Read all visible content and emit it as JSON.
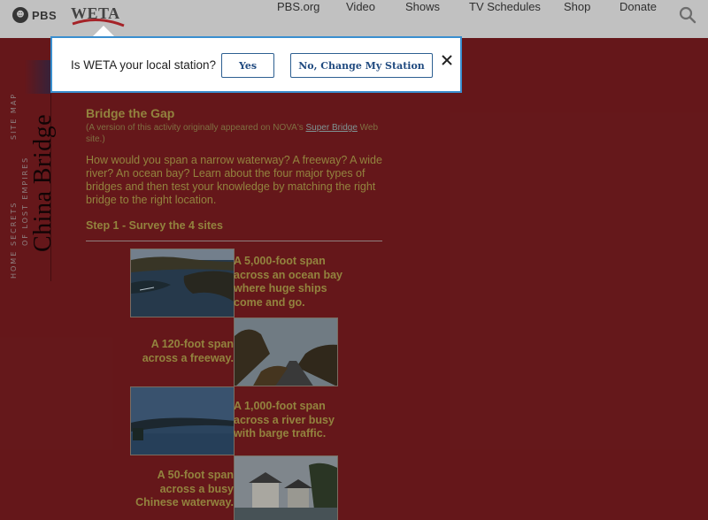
{
  "header": {
    "pbs_logo_text": "PBS",
    "station_logo_text": "WETA",
    "nav": [
      "PBS.org",
      "Video",
      "Shows",
      "TV Schedules",
      "Shop",
      "Donate"
    ]
  },
  "popup": {
    "question": "Is WETA your local station?",
    "yes_label": "Yes",
    "no_label": "No, Change My Station"
  },
  "leftnav": {
    "site_map": "SITE MAP",
    "secrets": "SECRETS",
    "lost_empires": "OF LOST EMPIRES",
    "home": "HOME",
    "title": "China Bridge"
  },
  "content": {
    "title": "Bridge the Gap",
    "note_prefix": "(A version of this activity originally appeared on NOVA's ",
    "note_link": "Super Bridge",
    "note_suffix": " Web site.)",
    "intro": "How would you span a narrow waterway? A freeway? A wide river? An ocean bay? Learn about the four major types of bridges and then test your knowledge by matching the right bridge to the right location.",
    "step": "Step 1 - Survey the 4 sites",
    "sites": [
      {
        "caption": "A 5,000-foot span across an ocean bay where huge ships come and go."
      },
      {
        "caption": "A 120-foot span across a freeway."
      },
      {
        "caption": "A 1,000-foot span across a river busy with barge traffic."
      },
      {
        "caption": "A 50-foot span across a busy Chinese waterway."
      }
    ]
  },
  "colors": {
    "page_bg": "#6e1a1d",
    "header_bg": "#d2d2d2",
    "text_gold": "#9f8f44",
    "popup_border": "#3a8fcf",
    "button_text": "#214b80"
  }
}
